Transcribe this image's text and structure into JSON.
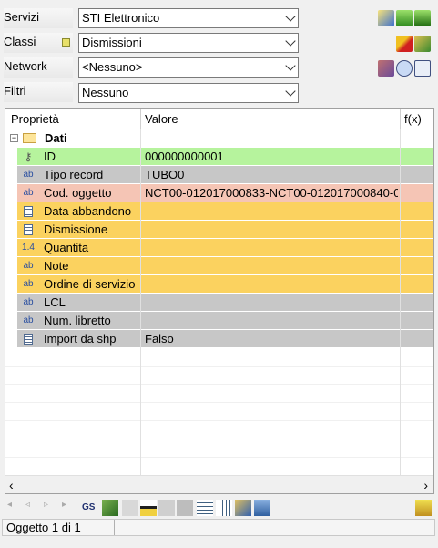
{
  "filters": {
    "servizi": {
      "label": "Servizi",
      "value": "STI Elettronico"
    },
    "classi": {
      "label": "Classi",
      "value": "Dismissioni"
    },
    "network": {
      "label": "Network",
      "value": "<Nessuno>"
    },
    "filtri": {
      "label": "Filtri",
      "value": "Nessuno"
    }
  },
  "grid": {
    "headers": {
      "property": "Proprietà",
      "value": "Valore",
      "fx": "f(x)"
    },
    "group": "Dati",
    "rows": [
      {
        "name": "ID",
        "value": "000000000001",
        "color": "#b6f39d",
        "icon": "key-icon"
      },
      {
        "name": "Tipo record",
        "value": "TUBO0",
        "color": "#c7c7c7",
        "icon": "text-type-icon"
      },
      {
        "name": "Cod. oggetto",
        "value": "NCT00-012017000833-NCT00-012017000840-0",
        "color": "#f5c5b5",
        "icon": "text-type-icon"
      },
      {
        "name": "Data abbandono",
        "value": "",
        "color": "#fbd25f",
        "icon": "date-type-icon"
      },
      {
        "name": "Dismissione",
        "value": "",
        "color": "#fbd25f",
        "icon": "list-type-icon"
      },
      {
        "name": "Quantita",
        "value": "",
        "color": "#fbd25f",
        "icon": "number-type-icon"
      },
      {
        "name": "Note",
        "value": "",
        "color": "#fbd25f",
        "icon": "text-type-icon"
      },
      {
        "name": "Ordine di servizio",
        "value": "",
        "color": "#fbd25f",
        "icon": "text-type-icon"
      },
      {
        "name": "LCL",
        "value": "",
        "color": "#c7c7c7",
        "icon": "text-type-icon"
      },
      {
        "name": "Num. libretto",
        "value": "",
        "color": "#c7c7c7",
        "icon": "text-type-icon"
      },
      {
        "name": "Import da shp",
        "value": "Falso",
        "color": "#c7c7c7",
        "icon": "list-type-icon"
      }
    ],
    "icon_glyphs": {
      "text-type-icon": "ab",
      "number-type-icon": "1.4"
    }
  },
  "toolbar": {
    "gs_label": "GS"
  },
  "status": {
    "text": "Oggetto 1 di 1"
  }
}
